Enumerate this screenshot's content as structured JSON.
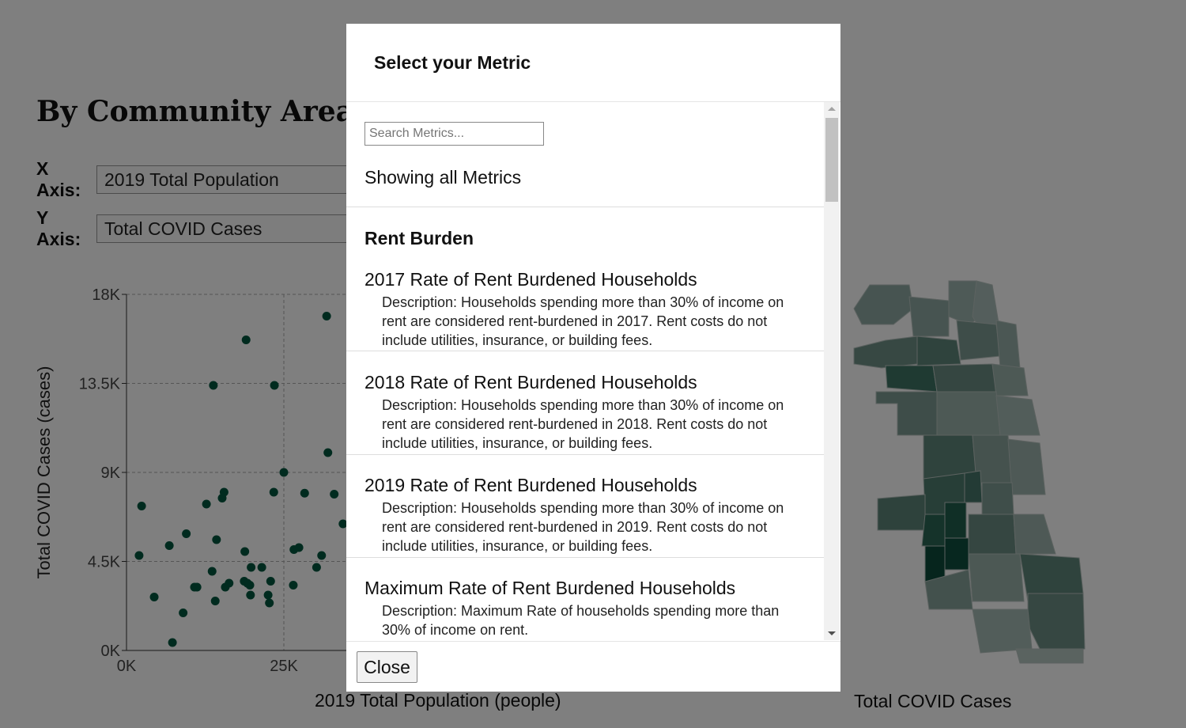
{
  "page": {
    "title": "By Community Area",
    "x_axis": {
      "label": "X Axis:",
      "value": "2019 Total Population"
    },
    "y_axis": {
      "label": "Y Axis:",
      "value": "Total COVID Cases"
    },
    "map_title": "Total COVID Cases"
  },
  "chart_data": {
    "type": "scatter",
    "xlabel": "2019 Total Population (people)",
    "ylabel": "Total COVID Cases (cases)",
    "xlim": [
      0,
      100000
    ],
    "ylim": [
      0,
      18000
    ],
    "x_ticks": [
      "0K",
      "25K"
    ],
    "y_ticks": [
      "0K",
      "4.5K",
      "9K",
      "13.5K",
      "18K"
    ],
    "grid": true,
    "point_color": "#00573f",
    "points": [
      [
        31800,
        16900
      ],
      [
        19000,
        15700
      ],
      [
        13800,
        13400
      ],
      [
        23500,
        13400
      ],
      [
        32000,
        10000
      ],
      [
        25000,
        9000
      ],
      [
        15500,
        8000
      ],
      [
        15200,
        7700
      ],
      [
        23400,
        8000
      ],
      [
        28300,
        7950
      ],
      [
        33000,
        7900
      ],
      [
        12700,
        7400
      ],
      [
        2400,
        7300
      ],
      [
        9500,
        5900
      ],
      [
        6800,
        5300
      ],
      [
        14300,
        5600
      ],
      [
        34400,
        6400
      ],
      [
        18800,
        5000
      ],
      [
        26600,
        5100
      ],
      [
        27400,
        5200
      ],
      [
        31000,
        4800
      ],
      [
        2000,
        4800
      ],
      [
        13600,
        4000
      ],
      [
        19800,
        4200
      ],
      [
        21500,
        4200
      ],
      [
        30200,
        4200
      ],
      [
        11200,
        3200
      ],
      [
        10800,
        3200
      ],
      [
        16300,
        3400
      ],
      [
        15700,
        3200
      ],
      [
        18700,
        3500
      ],
      [
        19200,
        3400
      ],
      [
        19600,
        3300
      ],
      [
        22900,
        3500
      ],
      [
        26500,
        3300
      ],
      [
        4400,
        2700
      ],
      [
        14100,
        2500
      ],
      [
        19700,
        2800
      ],
      [
        22500,
        2800
      ],
      [
        22700,
        2400
      ],
      [
        9000,
        1900
      ],
      [
        7300,
        400
      ]
    ]
  },
  "modal": {
    "title": "Select your Metric",
    "search_placeholder": "Search Metrics...",
    "showing": "Showing all Metrics",
    "category": "Rent Burden",
    "metrics": [
      {
        "name": "2017 Rate of Rent Burdened Households",
        "description": "Description: Households spending more than 30% of income on rent are considered rent-burdened in 2017. Rent costs do not include utilities, insurance, or building fees."
      },
      {
        "name": "2018 Rate of Rent Burdened Households",
        "description": "Description: Households spending more than 30% of income on rent are considered rent-burdened in 2018. Rent costs do not include utilities, insurance, or building fees."
      },
      {
        "name": "2019 Rate of Rent Burdened Households",
        "description": "Description: Households spending more than 30% of income on rent are considered rent-burdened in 2019. Rent costs do not include utilities, insurance, or building fees."
      },
      {
        "name": "Maximum Rate of Rent Burdened Households",
        "description": "Description: Maximum Rate of households spending more than 30% of income on rent."
      }
    ],
    "close_label": "Close"
  }
}
